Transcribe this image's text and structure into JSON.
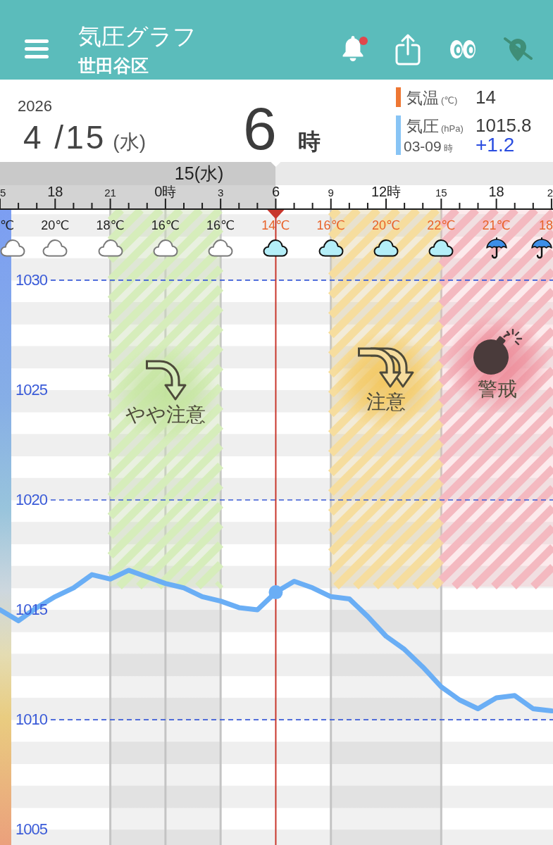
{
  "header": {
    "title": "気圧グラフ",
    "subtitle": "世田谷区",
    "notifications": {
      "unread": true
    },
    "location": {
      "enabled": false
    }
  },
  "summary": {
    "year": "2026",
    "date": "4 /15",
    "weekday": "(水)",
    "hour": "6",
    "hour_unit": "時",
    "readings": [
      {
        "label": "気温",
        "unit": "(℃)",
        "value": "14",
        "color": "#ee7733"
      },
      {
        "label": "気圧",
        "unit": "(hPa)",
        "value": "1015.8",
        "color": "#88c4f5",
        "period": "03-09",
        "period_unit": "時",
        "change": "+1.2"
      }
    ]
  },
  "timeline": {
    "day_label": "15(水)",
    "hours": [
      {
        "hour_label": "5",
        "temperature": "℃",
        "forecast": false,
        "kind": "cloudy"
      },
      {
        "hour_label": "18",
        "temperature": "20℃",
        "forecast": false,
        "kind": "cloudy"
      },
      {
        "hour_label": "21",
        "temperature": "18℃",
        "forecast": false,
        "kind": "cloudy"
      },
      {
        "temperature": "16℃",
        "forecast": false,
        "kind": "cloudy"
      },
      {
        "temperature": "16℃",
        "forecast": false,
        "kind": "cloudy"
      },
      {
        "temperature": "14℃",
        "forecast": true,
        "kind": "cloudy"
      },
      {
        "temperature": "16℃",
        "forecast": true,
        "kind": "cloudy"
      },
      {
        "temperature": "20℃",
        "forecast": true,
        "kind": "cloudy"
      },
      {
        "temperature": "22℃",
        "forecast": true,
        "kind": "cloudy"
      },
      {
        "temperature": "21℃",
        "forecast": true,
        "kind": "rain"
      },
      {
        "hour_label": "2",
        "temperature": "18",
        "forecast": true,
        "kind": "rain"
      }
    ],
    "alerts": [
      {
        "kind": "slight"
      },
      {
        "kind": "caution"
      },
      {
        "kind": "warning"
      }
    ],
    "chart_data": {
      "type": "line",
      "x": [
        -9,
        -8,
        -7,
        -6,
        -5,
        -4,
        -3,
        -2,
        -1,
        0,
        1,
        2,
        3,
        4,
        5,
        6,
        7,
        8,
        9,
        10,
        11,
        12,
        13,
        14,
        15,
        16,
        17,
        18,
        19,
        20,
        21
      ],
      "series": [
        {
          "color": "#6aaef5",
          "values": [
            1015.0,
            1014.5,
            1015.1,
            1015.6,
            1016.0,
            1016.6,
            1016.4,
            1016.8,
            1016.5,
            1016.2,
            1016.0,
            1015.6,
            1015.4,
            1015.1,
            1015.0,
            1015.8,
            1016.3,
            1016.0,
            1015.6,
            1015.5,
            1014.7,
            1013.8,
            1013.2,
            1012.4,
            1011.5,
            1010.9,
            1010.5,
            1011.0,
            1011.1,
            1010.5,
            1010.4
          ]
        }
      ],
      "xlim": [
        -9,
        21.08
      ],
      "ylim": [
        1004.3,
        1033.2
      ],
      "xticks": [
        {
          "value": 0,
          "label": "0時"
        },
        {
          "value": 3,
          "label": "3"
        },
        {
          "value": 6,
          "label": "6"
        },
        {
          "value": 9,
          "label": "9"
        },
        {
          "value": 12,
          "label": "12時"
        },
        {
          "value": 15,
          "label": "15"
        },
        {
          "value": 18,
          "label": "18"
        }
      ],
      "yticks": [
        1005,
        1010,
        1015,
        1020,
        1025,
        1030
      ],
      "grid": true,
      "ref_lines": [
        {
          "axis": "x",
          "value": 6,
          "color": "#c8372d"
        }
      ],
      "bands": [
        {
          "axis": "x",
          "from": -3,
          "to": 3,
          "color": "#d6edbb",
          "label": "やや注意"
        },
        {
          "axis": "x",
          "from": 9,
          "to": 15,
          "color": "#f6dd9e",
          "label": "注意"
        },
        {
          "axis": "x",
          "from": 15,
          "to": 21.08,
          "color": "#f4b9c0",
          "label": "警戒"
        }
      ]
    }
  }
}
